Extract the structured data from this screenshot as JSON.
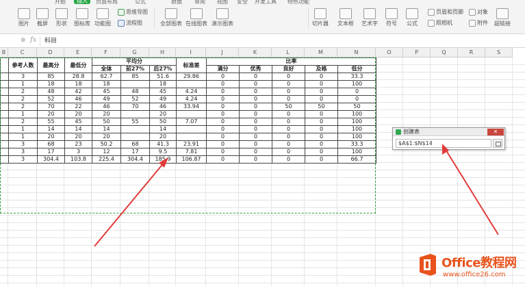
{
  "ribbon": {
    "tabs": [
      "开始",
      "插入",
      "页面布局",
      "公式",
      "数据",
      "审阅",
      "视图",
      "安全",
      "开发工具",
      "特色功能"
    ],
    "active_tab_index": 1,
    "groups": {
      "picture": "图片",
      "screenshot": "截屏",
      "shapes": "形状",
      "icon_lib": "图标库",
      "function_chart": "功能图",
      "mindmap": "思维导图",
      "flowchart": "流程图",
      "all_charts": "全部图表",
      "online_charts": "在线图表",
      "demo_charts": "演示图表",
      "slicer": "切片器",
      "textbox": "文本框",
      "wordart": "艺术字",
      "symbol": "符号",
      "formula": "公式",
      "header_footer": "页眉和页脚",
      "object": "对象",
      "camera": "照相机",
      "attachment": "附件",
      "hyperlink": "超链接"
    }
  },
  "formula_bar": {
    "fx": "fx",
    "value": "科目"
  },
  "columns": [
    "B",
    "C",
    "D",
    "E",
    "F",
    "G",
    "H",
    "I",
    "J",
    "K",
    "L",
    "M",
    "N",
    "O",
    "P",
    "Q",
    "R",
    "S"
  ],
  "table": {
    "group_headers": {
      "avg": "平均分",
      "ratio": "比率"
    },
    "headers": {
      "b": "",
      "count": "参考人数",
      "max": "最高分",
      "min": "最低分",
      "std": "标准差"
    },
    "sub_headers": [
      "全体",
      "前27%",
      "后27%",
      "满分",
      "优秀",
      "良好",
      "及格",
      "低分"
    ],
    "rows": [
      [
        "",
        "3",
        "85",
        "28.8",
        "62.7",
        "85",
        "51.6",
        "29.86",
        "0",
        "0",
        "0",
        "0",
        "33.3"
      ],
      [
        "",
        "1",
        "18",
        "18",
        "18",
        "",
        "18",
        "",
        "0",
        "0",
        "0",
        "0",
        "100"
      ],
      [
        "",
        "2",
        "48",
        "42",
        "45",
        "48",
        "45",
        "4.24",
        "0",
        "0",
        "0",
        "0",
        "0"
      ],
      [
        "",
        "2",
        "52",
        "46",
        "49",
        "52",
        "49",
        "4.24",
        "0",
        "0",
        "0",
        "0",
        "0"
      ],
      [
        "",
        "2",
        "70",
        "22",
        "46",
        "70",
        "46",
        "33.94",
        "0",
        "0",
        "50",
        "50",
        "50"
      ],
      [
        "",
        "1",
        "20",
        "20",
        "20",
        "",
        "20",
        "",
        "0",
        "0",
        "0",
        "0",
        "100"
      ],
      [
        "",
        "2",
        "55",
        "45",
        "50",
        "55",
        "50",
        "7.07",
        "0",
        "0",
        "0",
        "0",
        "100"
      ],
      [
        "",
        "1",
        "14",
        "14",
        "14",
        "",
        "14",
        "",
        "0",
        "0",
        "0",
        "0",
        "100"
      ],
      [
        "",
        "1",
        "20",
        "20",
        "20",
        "",
        "20",
        "",
        "0",
        "0",
        "0",
        "0",
        "100"
      ],
      [
        "",
        "3",
        "68",
        "23",
        "50.2",
        "68",
        "41.3",
        "23.91",
        "0",
        "0",
        "0",
        "0",
        "33.3"
      ],
      [
        "",
        "3",
        "17",
        "3",
        "12",
        "17",
        "9.5",
        "7.81",
        "0",
        "0",
        "0",
        "0",
        "100"
      ],
      [
        "",
        "3",
        "304.4",
        "103.8",
        "225.4",
        "304.4",
        "185.9",
        "106.87",
        "0",
        "0",
        "0",
        "0",
        "66.7"
      ]
    ]
  },
  "dialog": {
    "title": "创建表",
    "range": "$A$1:$N$14",
    "close": "✕"
  },
  "watermark": {
    "brand": "Office教程网",
    "url": "www.office26.com"
  },
  "colors": {
    "accent": "#28a745",
    "marquee": "#2e9e3e",
    "arrow": "#e23b3b",
    "brand": "#e8521b"
  }
}
